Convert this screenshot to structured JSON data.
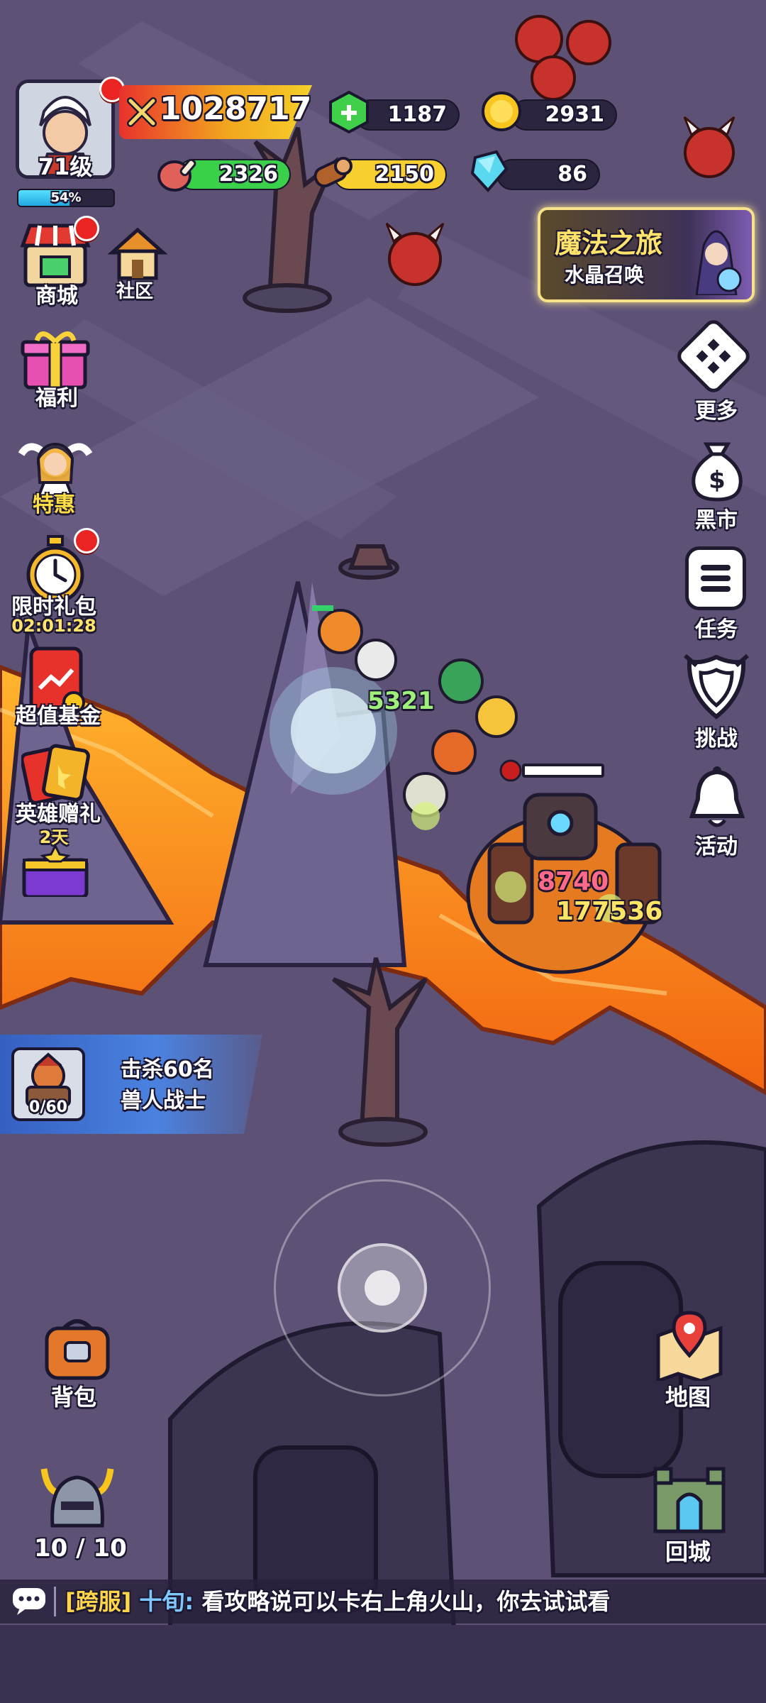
{
  "player": {
    "level_label": "71级",
    "xp_percent_label": "54%",
    "xp_fraction": 0.54,
    "power": "1028717"
  },
  "resources": {
    "gems": "1187",
    "gold": "2931",
    "meat": "2326",
    "wood": "2150",
    "crystal": "86"
  },
  "event_banner": {
    "title": "魔法之旅",
    "subtitle": "水晶召唤"
  },
  "left_menu": {
    "shop": "商城",
    "community": "社区",
    "welfare": "福利",
    "special_offer": "特惠",
    "limited_gift": "限时礼包",
    "limited_gift_timer": "02:01:28",
    "fund": "超值基金",
    "hero_gift": "英雄赠礼",
    "hero_gift_days": "2天"
  },
  "right_menu": {
    "more": "更多",
    "black_market": "黑市",
    "tasks": "任务",
    "challenge": "挑战",
    "events": "活动"
  },
  "battle": {
    "damage_1": "8740",
    "damage_2": "177536",
    "damage_3": "5321"
  },
  "mission": {
    "line1": "击杀60名",
    "line2": "兽人战士",
    "progress": "0/60"
  },
  "bottom": {
    "backpack": "背包",
    "map": "地图",
    "team_count": "10 / 10",
    "return_city": "回城"
  },
  "chat": {
    "channel": "[跨服]",
    "sender": "十旬:",
    "message": "看攻略说可以卡右上角火山，你去试试看"
  },
  "colors": {
    "lava": "#f57a12",
    "ground": "#5b5074",
    "accent_red": "#ea2323",
    "channel": "#ffd54a",
    "sender": "#7fc8ff"
  }
}
